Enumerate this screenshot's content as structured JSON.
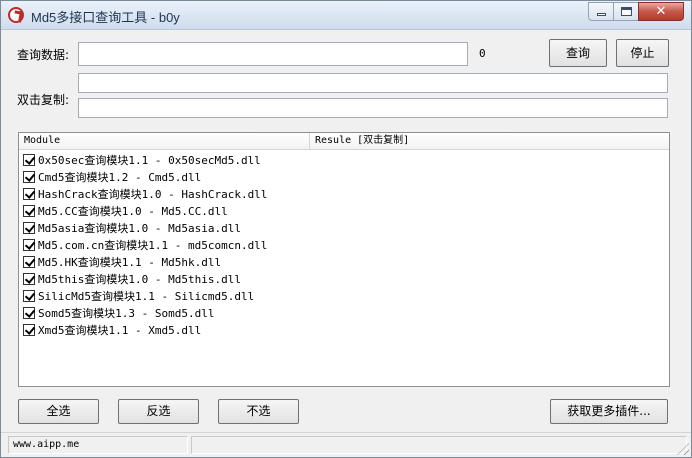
{
  "window": {
    "title": "Md5多接口查询工具 - b0y"
  },
  "query": {
    "label": "查询数据:",
    "value": "",
    "count": "0"
  },
  "copy": {
    "label": "双击复制:",
    "value1": "",
    "value2": ""
  },
  "buttons": {
    "search": "查询",
    "stop": "停止",
    "select_all": "全选",
    "invert": "反选",
    "select_none": "不选",
    "more_plugins": "获取更多插件..."
  },
  "table": {
    "headers": [
      "Module",
      "Resule [双击复制]"
    ],
    "rows": [
      {
        "label": "0x50sec查询模块1.1 - 0x50secMd5.dll",
        "checked": true
      },
      {
        "label": "Cmd5查询模块1.2 - Cmd5.dll",
        "checked": true
      },
      {
        "label": "HashCrack查询模块1.0 - HashCrack.dll",
        "checked": true
      },
      {
        "label": "Md5.CC查询模块1.0 - Md5.CC.dll",
        "checked": true
      },
      {
        "label": "Md5asia查询模块1.0 - Md5asia.dll",
        "checked": true
      },
      {
        "label": "Md5.com.cn查询模块1.1 - md5comcn.dll",
        "checked": true
      },
      {
        "label": "Md5.HK查询模块1.1 - Md5hk.dll",
        "checked": true
      },
      {
        "label": "Md5this查询模块1.0 - Md5this.dll",
        "checked": true
      },
      {
        "label": "SilicMd5查询模块1.1 - Silicmd5.dll",
        "checked": true
      },
      {
        "label": "Somd5查询模块1.3 - Somd5.dll",
        "checked": true
      },
      {
        "label": "Xmd5查询模块1.1 - Xmd5.dll",
        "checked": true
      }
    ]
  },
  "status": {
    "left": "www.aipp.me",
    "right": ""
  },
  "icons": {
    "app": "app-icon",
    "minimize": "minimize-icon",
    "maximize": "maximize-icon",
    "close": "close-icon",
    "checkbox": "checkbox-checked-icon",
    "grip": "size-grip-icon"
  }
}
